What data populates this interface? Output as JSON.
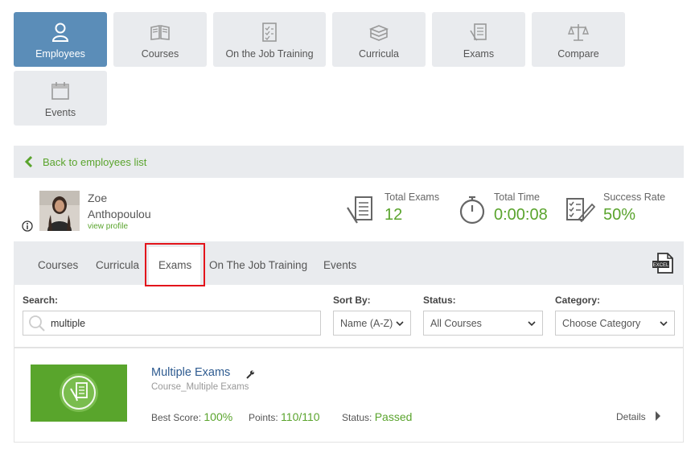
{
  "nav": {
    "employees": "Employees",
    "courses": "Courses",
    "ojt": "On the Job Training",
    "curricula": "Curricula",
    "exams": "Exams",
    "compare": "Compare",
    "events": "Events"
  },
  "back_link": "Back to employees list",
  "profile": {
    "first_name": "Zoe",
    "last_name": "Anthopoulou",
    "view_profile": "view profile"
  },
  "stats": {
    "total_exams_label": "Total Exams",
    "total_exams": "12",
    "total_time_label": "Total Time",
    "total_time": "0:00:08",
    "success_rate_label": "Success Rate",
    "success_rate": "50%"
  },
  "tabs": [
    "Courses",
    "Curricula",
    "Exams",
    "On The Job Training",
    "Events"
  ],
  "excel_label": "EXCEL",
  "filters": {
    "search_label": "Search:",
    "search_value": "multiple",
    "sort_label": "Sort By:",
    "sort_value": "Name (A-Z)",
    "status_label": "Status:",
    "status_value": "All Courses",
    "category_label": "Category:",
    "category_value": "Choose Category"
  },
  "result": {
    "title": "Multiple Exams",
    "subtitle": "Course_Multiple Exams",
    "best_score_label": "Best Score:",
    "best_score": "100%",
    "points_label": "Points:",
    "points": "110/110",
    "status_label": "Status:",
    "status": "Passed",
    "details": "Details"
  },
  "colors": {
    "accent": "#5aa42d",
    "active_tile": "#5b8db8",
    "highlight": "#e3141b"
  }
}
